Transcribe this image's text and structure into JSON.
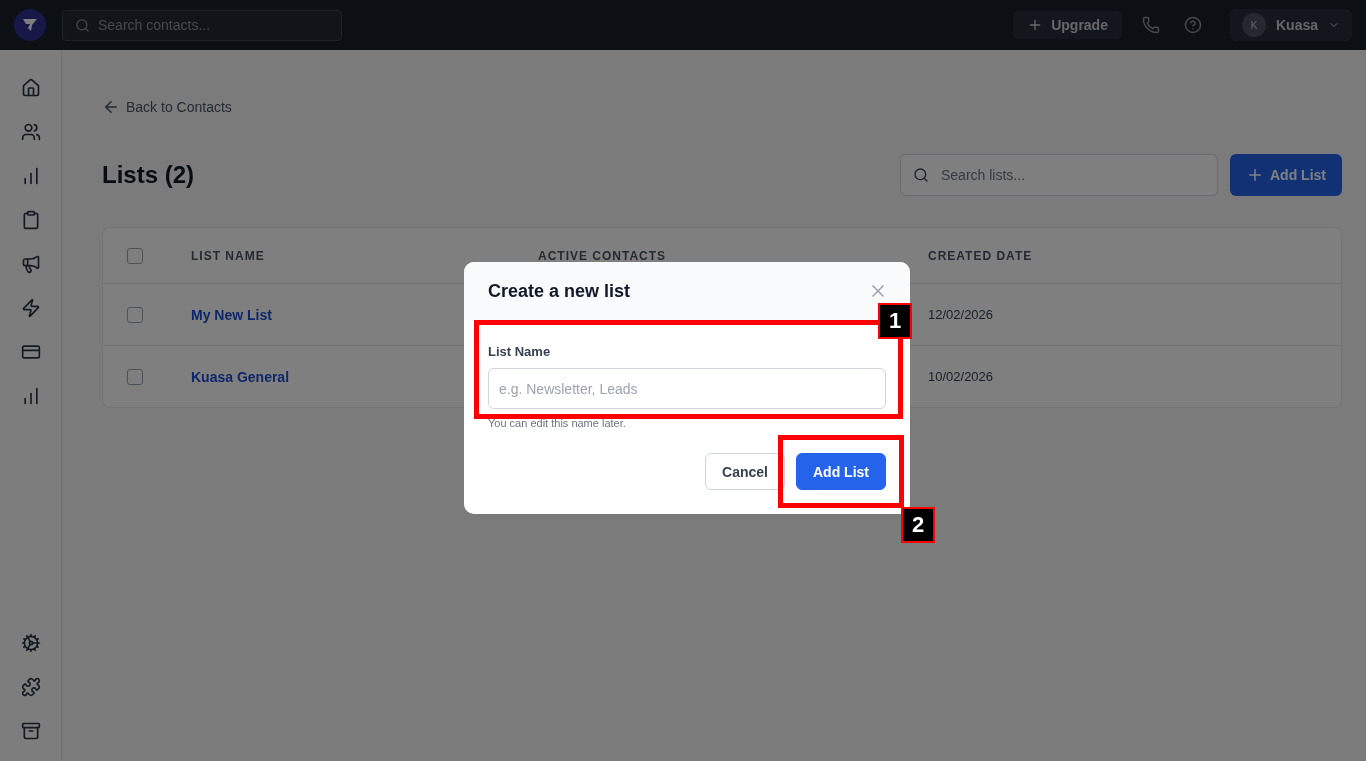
{
  "topbar": {
    "search_placeholder": "Search contacts...",
    "upgrade_label": "Upgrade",
    "user": {
      "initial": "K",
      "name": "Kuasa"
    }
  },
  "page": {
    "back_link": "Back to Contacts",
    "title": "Lists (2)",
    "search_placeholder": "Search lists...",
    "add_button": "Add List"
  },
  "table": {
    "select_all_checked": false,
    "columns": [
      "LIST NAME",
      "ACTIVE CONTACTS",
      "CREATED DATE"
    ],
    "rows": [
      {
        "checked": false,
        "name": "My New List",
        "created": "12/02/2026"
      },
      {
        "checked": false,
        "name": "Kuasa General",
        "created": "10/02/2026"
      }
    ]
  },
  "modal": {
    "title": "Create a new list",
    "field": {
      "label": "List Name",
      "placeholder": "e.g. Newsletter, Leads",
      "hint": "You can edit this name later.",
      "annotation": "1"
    },
    "buttons": [
      {
        "kind": "secondary",
        "label": "Cancel"
      },
      {
        "kind": "primary",
        "label": "Add List",
        "annotation": "2"
      }
    ]
  }
}
